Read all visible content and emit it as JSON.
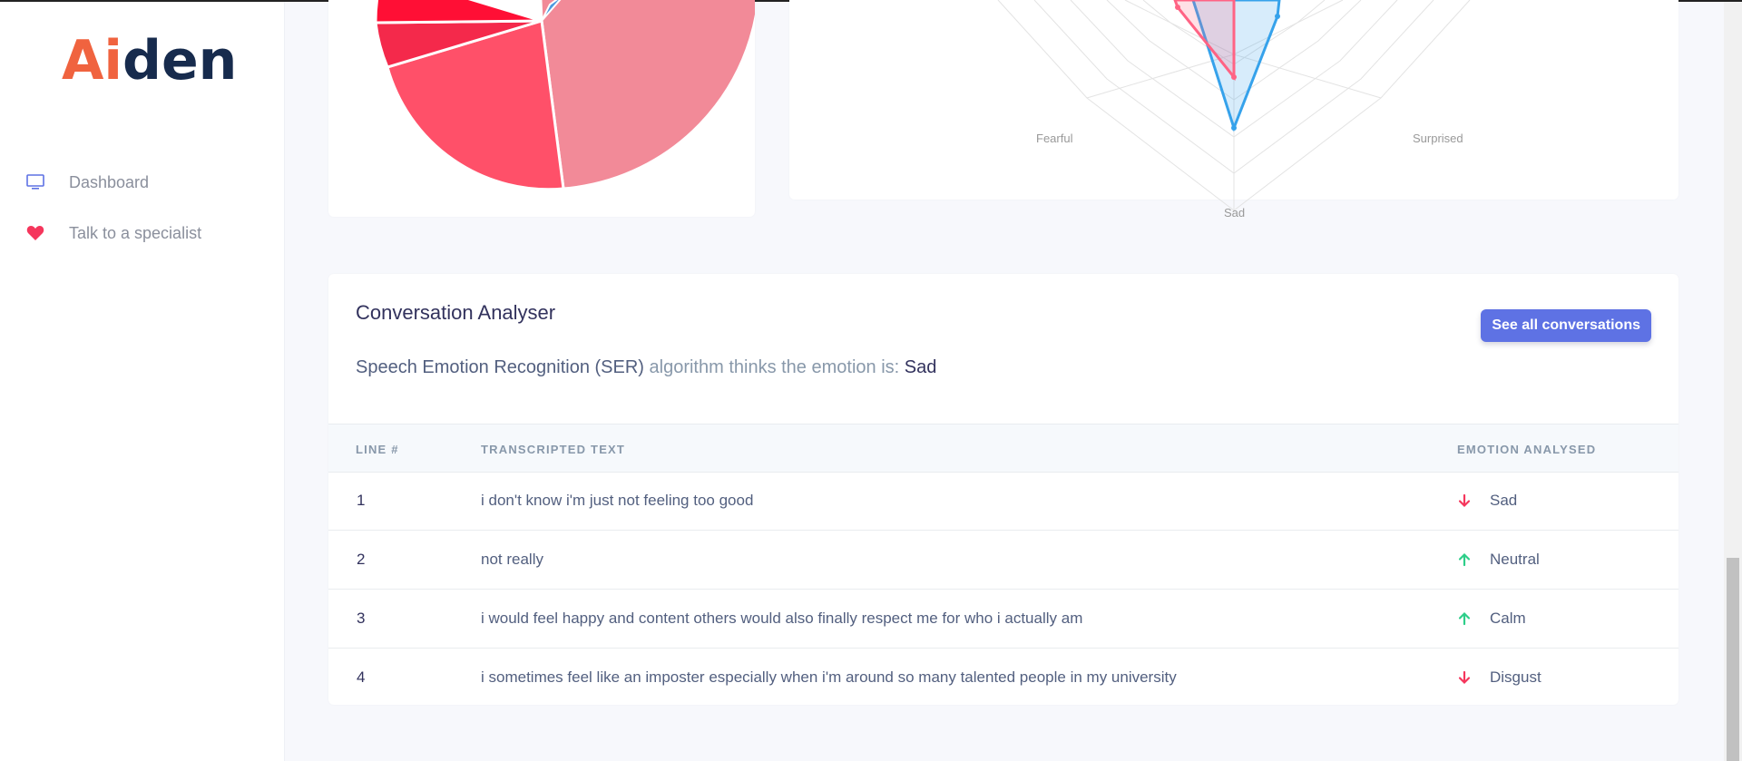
{
  "app": {
    "logo_part1": "Ai",
    "logo_part2": "den"
  },
  "sidebar": {
    "items": [
      {
        "label": "Dashboard",
        "icon": "monitor-icon"
      },
      {
        "label": "Talk to a specialist",
        "icon": "heart-icon"
      }
    ]
  },
  "radar": {
    "labels": {
      "fearful": "Fearful",
      "surprised": "Surprised",
      "sad": "Sad"
    }
  },
  "conversation": {
    "title": "Conversation Analyser",
    "see_all_label": "See all conversations",
    "ser_prefix": "Speech Emotion Recognition (SER)",
    "ser_middle": " algorithm thinks the emotion is: ",
    "ser_emotion": "Sad",
    "columns": {
      "line": "LINE #",
      "text": "TRANSCRIPTED TEXT",
      "emotion": "EMOTION ANALYSED"
    },
    "rows": [
      {
        "line": "1",
        "text": "i don't know i'm just not feeling too good",
        "emotion": "Sad",
        "trend": "down"
      },
      {
        "line": "2",
        "text": "not really",
        "emotion": "Neutral",
        "trend": "up"
      },
      {
        "line": "3",
        "text": "i would feel happy and content others would also finally respect me for who i actually am",
        "emotion": "Calm",
        "trend": "up"
      },
      {
        "line": "4",
        "text": "i sometimes feel like an imposter especially when i'm around so many talented people in my university",
        "emotion": "Disgust",
        "trend": "down"
      }
    ]
  },
  "colors": {
    "accent": "#5e72e4",
    "logo_orange": "#f0633f",
    "logo_navy": "#172b4d",
    "trend_up": "#2dce89",
    "trend_down": "#f5365c",
    "heart": "#f5365c"
  }
}
